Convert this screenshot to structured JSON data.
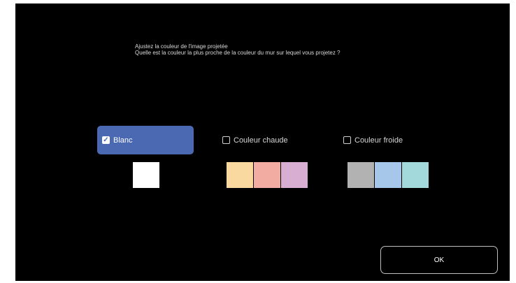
{
  "prompt": {
    "line1": "Ajustez la couleur de l'image projetée",
    "line2": "Quelle est la couleur la plus proche de la couleur du mur sur lequel vous projetez ?"
  },
  "options": [
    {
      "label": "Blanc",
      "checked": true,
      "swatches": [
        "#ffffff"
      ]
    },
    {
      "label": "Couleur chaude",
      "checked": false,
      "swatches": [
        "#f9d9a0",
        "#f3aca1",
        "#d8aed2"
      ]
    },
    {
      "label": "Couleur froide",
      "checked": false,
      "swatches": [
        "#b2b2b2",
        "#a7c7ea",
        "#a3d9db"
      ]
    }
  ],
  "ok_label": "OK",
  "colors": {
    "background": "#000000",
    "selected": "#4b68b3",
    "text": "#d6d6d6"
  },
  "icons": {
    "checkmark": "checkmark-icon"
  }
}
